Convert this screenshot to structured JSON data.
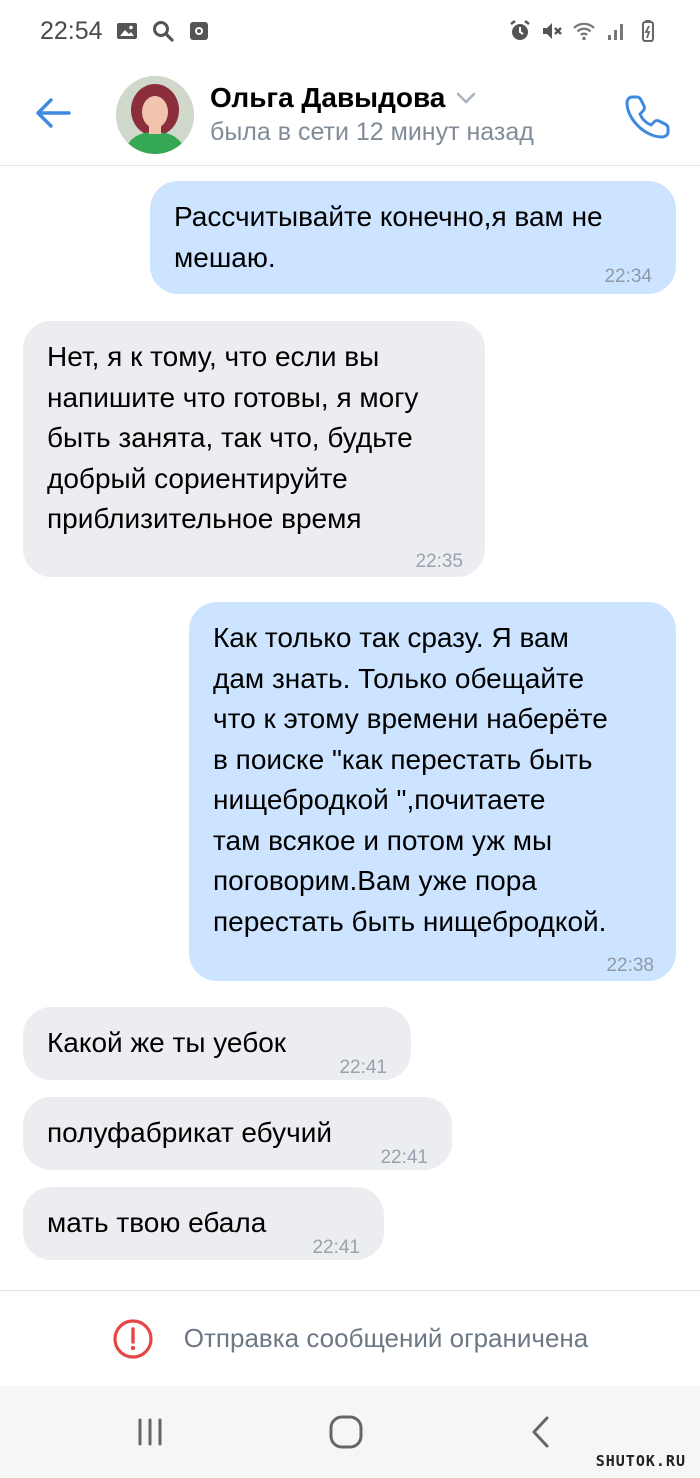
{
  "status_bar": {
    "time": "22:54",
    "left_icons": [
      "image-icon",
      "search-icon",
      "screen-record-icon"
    ],
    "right_icons": [
      "alarm-icon",
      "mute-icon",
      "wifi-icon",
      "signal-icon",
      "battery-icon"
    ]
  },
  "header": {
    "name": "Ольга Давыдова",
    "status": "была в сети 12 минут назад",
    "icons": {
      "back": "back-arrow-icon",
      "call": "phone-icon",
      "dropdown": "chevron-down-icon"
    }
  },
  "messages": [
    {
      "direction": "out",
      "text": "Рассчитывайте конечно,я вам не\nмешаю.",
      "time": "22:34"
    },
    {
      "direction": "in",
      "text": "Нет, я к тому, что если вы\nнапишите что готовы, я могу\nбыть занята, так что, будьте\nдобрый сориентируйте\nприблизительное время",
      "time": "22:35"
    },
    {
      "direction": "out",
      "text": "Как только так сразу. Я вам\nдам знать. Только обещайте\nчто к этому времени наберёте\nв поиске \"как перестать быть\nнищебродкой \",почитаете\nтам всякое и потом уж мы\nпоговорим.Вам уже пора\nперестать быть нищебродкой.",
      "time": "22:38"
    },
    {
      "direction": "in",
      "text": "Какой же ты уебок",
      "time": "22:41"
    },
    {
      "direction": "in",
      "text": "полуфабрикат ебучий",
      "time": "22:41"
    },
    {
      "direction": "in",
      "text": "мать твою ебала",
      "time": "22:41"
    }
  ],
  "restricted": {
    "icon": "alert-circle-icon",
    "text": "Отправка сообщений ограничена"
  },
  "nav_bar": {
    "icons": [
      "recent-apps-icon",
      "home-icon",
      "back-icon"
    ]
  },
  "watermark": "SHUTOK.RU",
  "colors": {
    "accent": "#3f8ae0",
    "outgoing_bubble": "#cce4ff",
    "incoming_bubble": "#ebedf0",
    "alert": "#e64646"
  }
}
